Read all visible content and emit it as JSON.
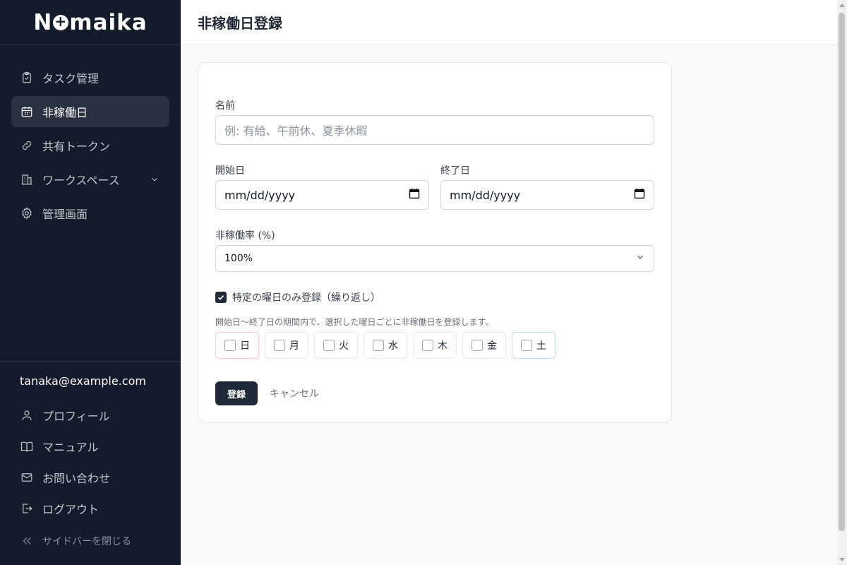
{
  "app": {
    "logo_text_pre": "N",
    "logo_text_post": "maika"
  },
  "sidebar": {
    "items": [
      {
        "label": "タスク管理",
        "icon": "clipboard-icon"
      },
      {
        "label": "非稼働日",
        "icon": "calendar-icon",
        "active": true
      },
      {
        "label": "共有トークン",
        "icon": "link-icon"
      },
      {
        "label": "ワークスペース",
        "icon": "building-icon",
        "has_submenu": true
      },
      {
        "label": "管理画面",
        "icon": "gear-icon"
      }
    ],
    "user_email": "tanaka@example.com",
    "bottom_items": [
      {
        "label": "プロフィール",
        "icon": "user-icon"
      },
      {
        "label": "マニュアル",
        "icon": "book-icon"
      },
      {
        "label": "お問い合わせ",
        "icon": "mail-icon"
      },
      {
        "label": "ログアウト",
        "icon": "logout-icon"
      }
    ],
    "collapse_label": "サイドバーを閉じる"
  },
  "header": {
    "title": "非稼働日登録"
  },
  "form": {
    "name_label": "名前",
    "name_placeholder": "例: 有給、午前休、夏季休暇",
    "start_label": "開始日",
    "start_value": "mm/dd/yyyy",
    "end_label": "終了日",
    "end_value": "mm/dd/yyyy",
    "rate_label": "非稼働率 (%)",
    "rate_value": "100%",
    "repeat_label": "特定の曜日のみ登録（繰り返し）",
    "repeat_checked": true,
    "help_text": "開始日〜終了日の期間内で、選択した曜日ごとに非稼働日を登録します。",
    "days": [
      "日",
      "月",
      "火",
      "水",
      "木",
      "金",
      "土"
    ],
    "submit_label": "登録",
    "cancel_label": "キャンセル"
  },
  "colors": {
    "sidebar_bg": "#141b2b",
    "primary": "#1f2937",
    "sunday_border": "#fecaca",
    "saturday_border": "#bfdbfe"
  }
}
